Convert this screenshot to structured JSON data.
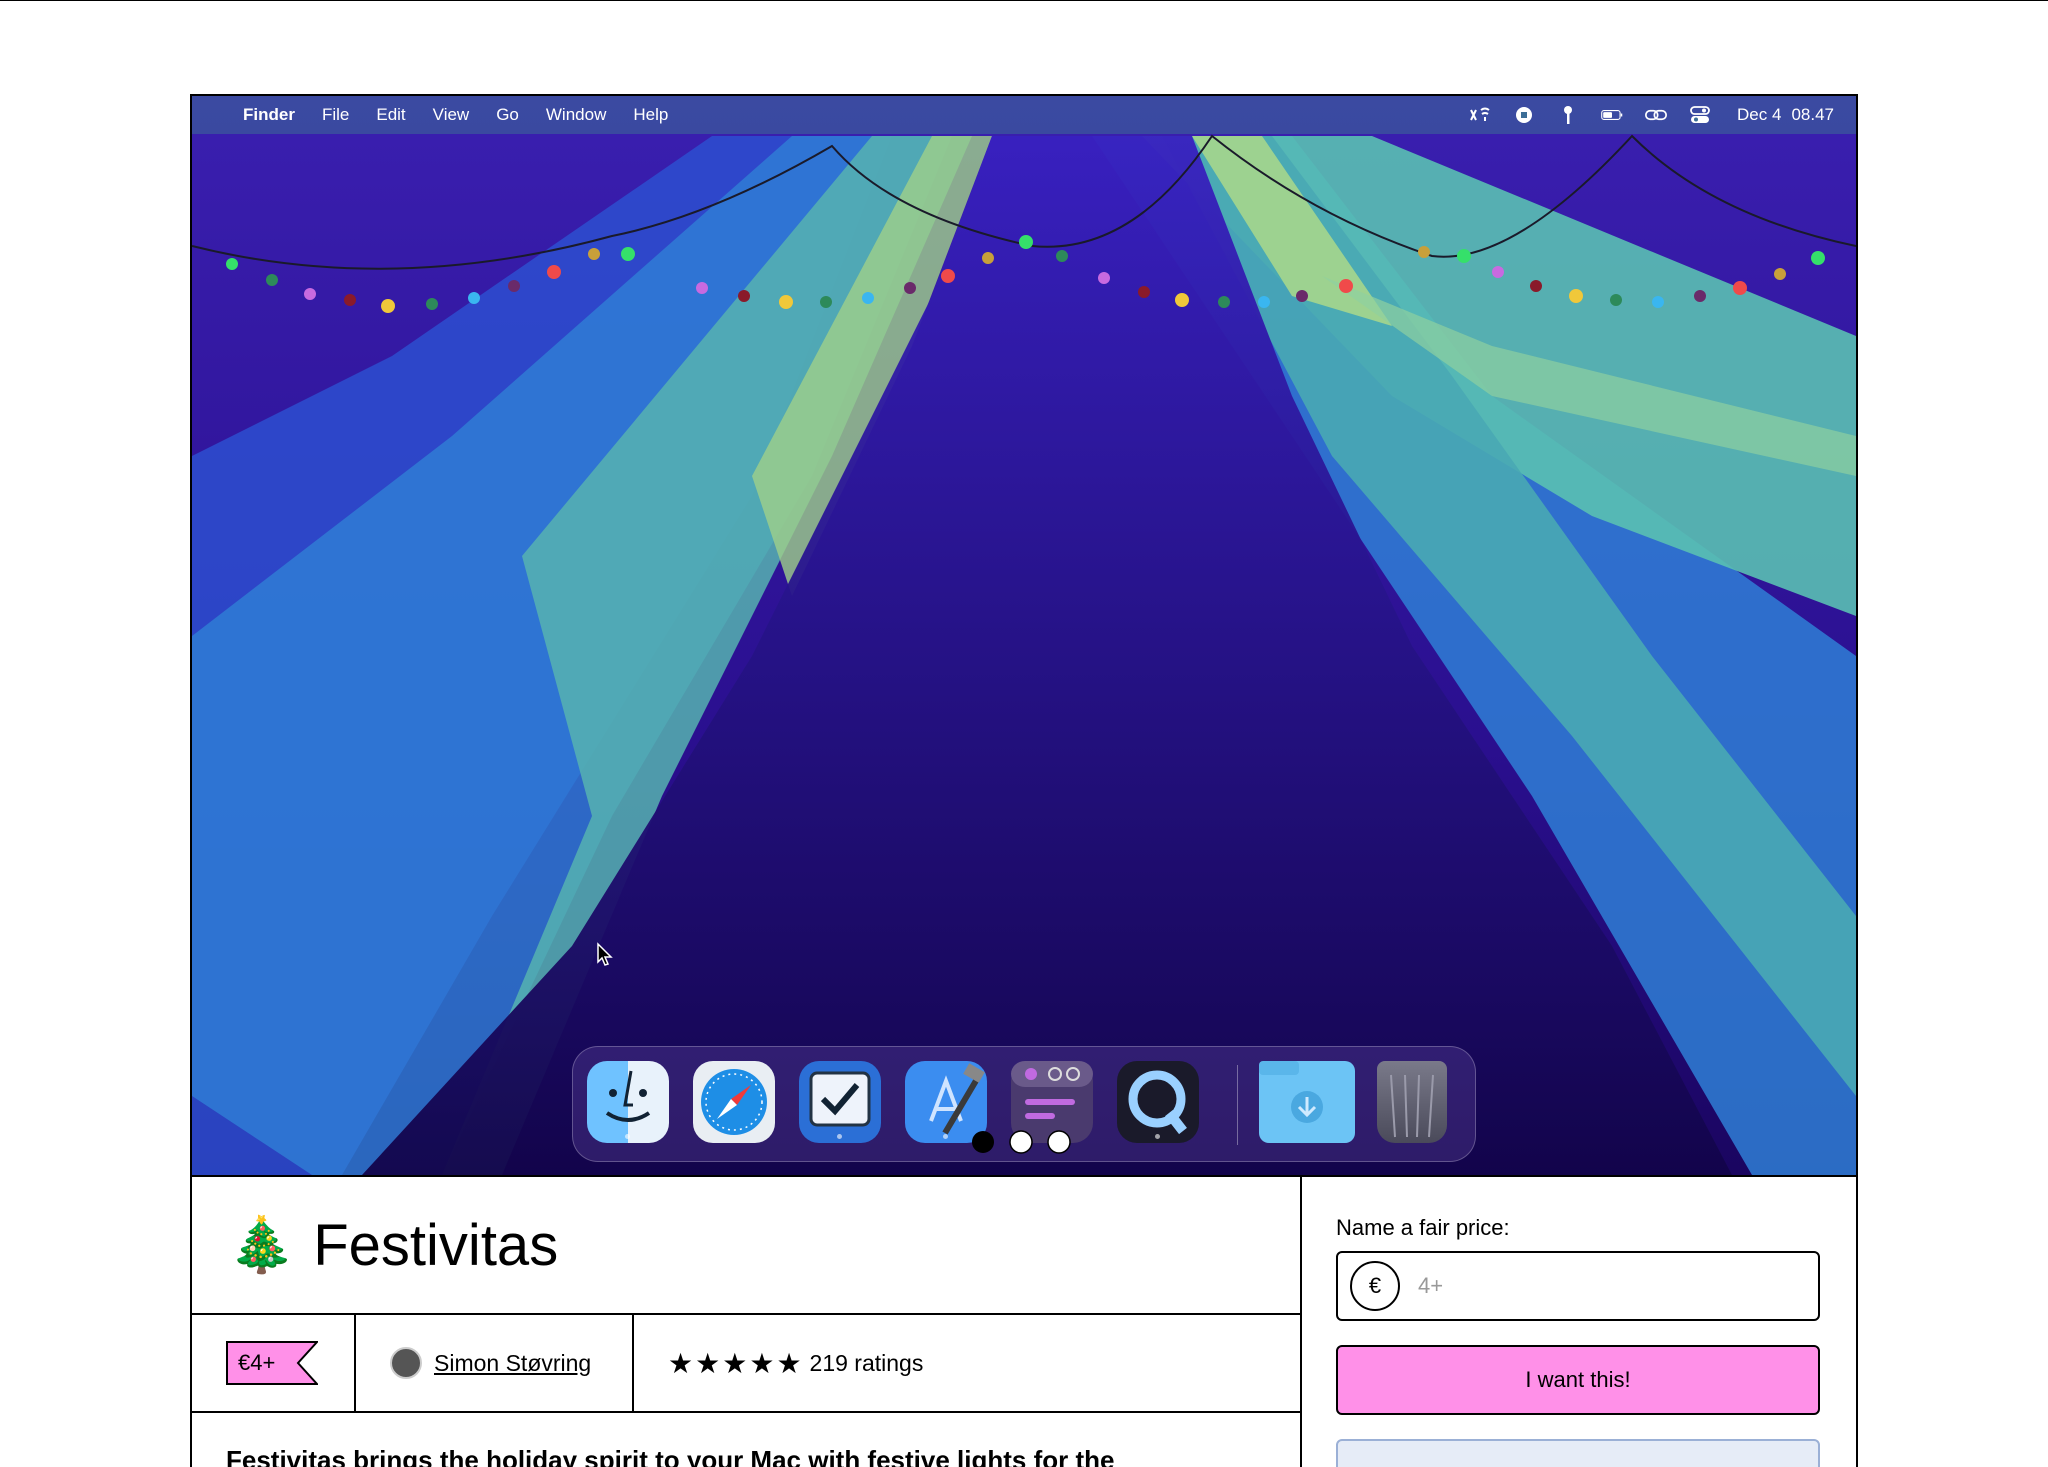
{
  "menubar": {
    "apple_glyph": "",
    "app_name": "Finder",
    "menus": [
      "File",
      "Edit",
      "View",
      "Go",
      "Window",
      "Help"
    ],
    "date": "Dec 4",
    "time": "08.47",
    "status_icons": [
      "wifi-lights-icon",
      "record-icon",
      "key-icon",
      "battery-icon",
      "link-icon",
      "control-center-icon"
    ]
  },
  "dock": {
    "apps": [
      "finder-icon",
      "safari-icon",
      "tasks-icon",
      "xcode-icon",
      "app-with-dots-icon",
      "quicktime-icon",
      "downloads-folder-icon",
      "trash-icon"
    ]
  },
  "product": {
    "emoji": "🎄",
    "title": "Festivitas",
    "price": "€4+",
    "author": "Simon Støvring",
    "rating_stars": 5,
    "star_glyph": "★",
    "ratings_text": "219 ratings",
    "description": "Festivitas brings the holiday spirit to your Mac with festive lights for the"
  },
  "purchase": {
    "label": "Name a fair price:",
    "currency": "€",
    "placeholder": "4+",
    "button": "I want this!"
  },
  "colors": {
    "accent_pink": "#ff90e8",
    "menubar": "#3c6e96"
  }
}
